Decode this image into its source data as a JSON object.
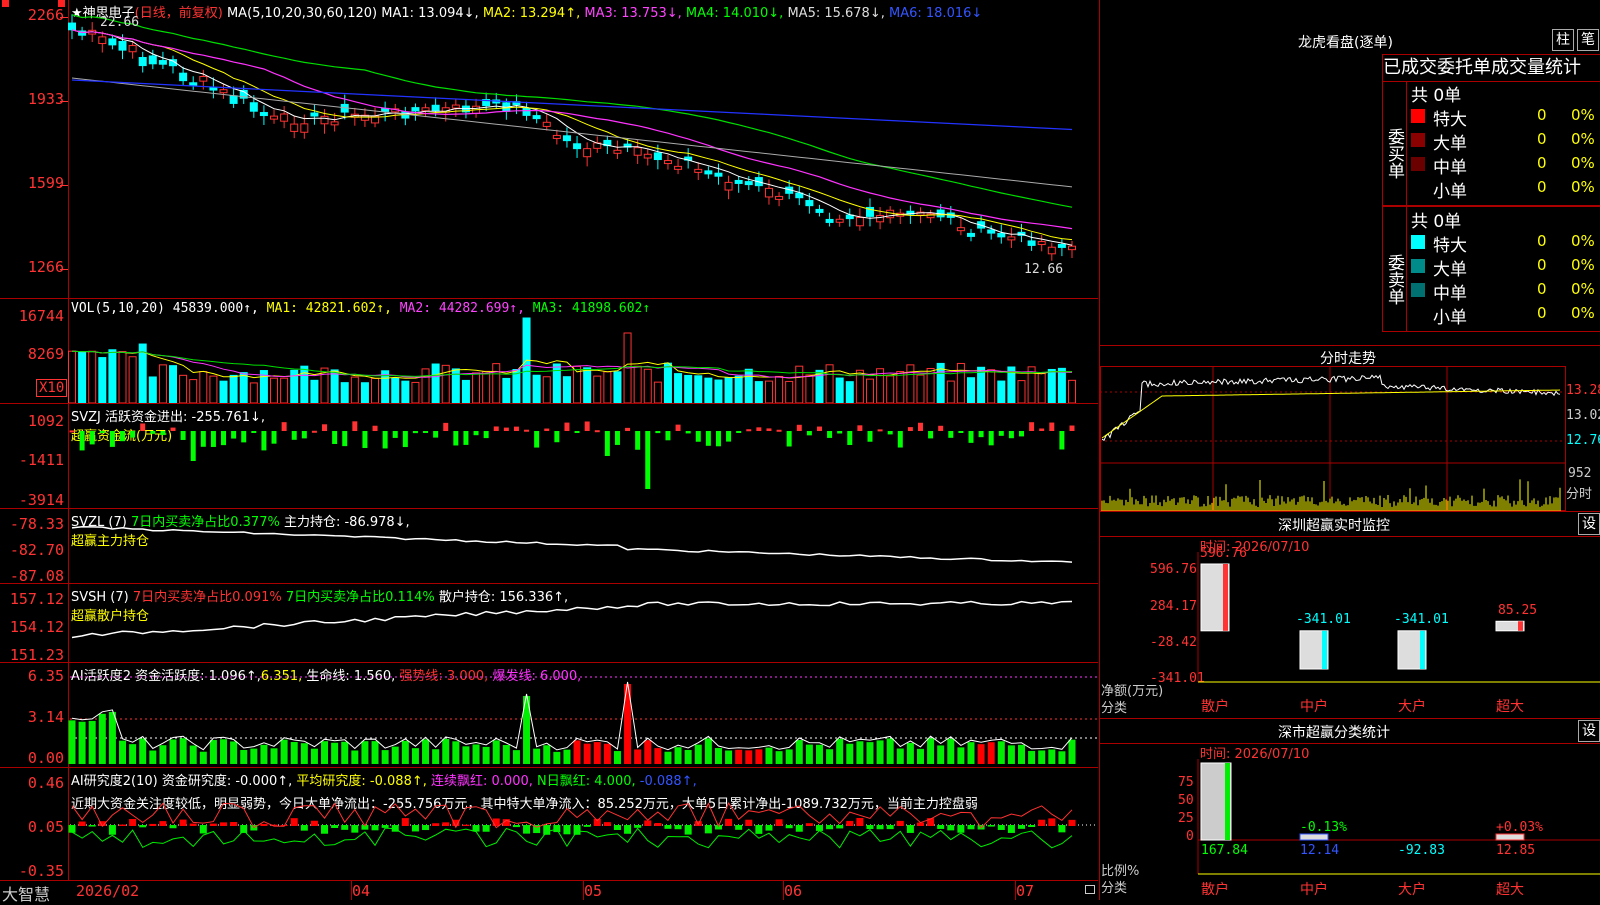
{
  "stock": {
    "name": "★神思电子",
    "period": "(日线，前复权)",
    "high_label": "22.66",
    "low_label": "12.66"
  },
  "price_ma": {
    "prefix": "MA(5,10,20,30,60,120)",
    "ma1": "MA1: 13.094↓,",
    "ma2": "MA2: 13.294↑,",
    "ma3": "MA3: 13.753↓,",
    "ma4": "MA4: 14.010↓,",
    "ma5": "MA5: 15.678↓,",
    "ma6": "MA6: 18.016↓",
    "ticks": [
      "2266",
      "1933",
      "1599",
      "1266"
    ]
  },
  "vol": {
    "prefix": "VOL(5,10,20)",
    "value": "45839.000↑,",
    "ma1": "MA1: 42821.602↑,",
    "ma2": "MA2: 44282.699↑,",
    "ma3": "MA3: 41898.602↑",
    "ticks": [
      "16744",
      "8269"
    ],
    "unit": "X10"
  },
  "svzj": {
    "line1": "SVZJ  活跃资金进出: -255.761↓,",
    "line2": "超赢资金流(万元)",
    "ticks": [
      "1092",
      "-1411",
      "-3914"
    ]
  },
  "svzl": {
    "p1": "SVZL (7)",
    "p2": "7日内买卖净占比0.377%",
    "p3": "主力持仓: -86.978↓,",
    "line2": "超赢主力持仓",
    "ticks": [
      "-78.33",
      "-82.70",
      "-87.08"
    ]
  },
  "svsh": {
    "p1": "SVSH (7)",
    "p2": "7日内买卖净占比0.091%",
    "p3": "7日内买卖净占比0.114%",
    "p4": "散户持仓: 156.336↑,",
    "line2": "超赢散户持仓",
    "ticks": [
      "157.12",
      "154.12",
      "151.23"
    ]
  },
  "ai_active": {
    "p1": "AI活跃度2",
    "p2": "资金活跃度: 1.096↑,",
    "p3": "6.351,",
    "p4": "生命线: 1.560,",
    "p5": "强势线: 3.000,",
    "p6": "爆发线: 6.000,",
    "ticks": [
      "6.35",
      "3.14",
      "0.00"
    ]
  },
  "ai_research": {
    "p1": "AI研究度2(10)",
    "p2": "资金研究度: -0.000↑,",
    "p3": "平均研究度: -0.088↑,",
    "p4": "连续飘红: 0.000,",
    "p5": "N日飘红: 4.000,",
    "p6": "-0.088↑,",
    "comment": "近期大资金关注度较低，明显弱势，今日大单净流出：-255.756万元，其中特大单净流入：85.252万元，大单5日累计净出-1089.732万元，当前主力控盘弱",
    "ticks": [
      "0.46",
      "0.05",
      "-0.35"
    ]
  },
  "date_axis": {
    "brand": "大智慧",
    "labels": [
      "2026/02",
      "04",
      "05",
      "06",
      "07"
    ]
  },
  "longhu": {
    "title": "龙虎看盘(逐单)",
    "btn_bar": "柱",
    "btn_pen": "笔",
    "subtitle": "已成交委托单成交量统计",
    "buy_label": "委买单",
    "sell_label": "委卖单",
    "buy_total": "共 0单",
    "sell_total": "共 0单",
    "rows": [
      {
        "name": "特大",
        "count": "0",
        "pct": "0%"
      },
      {
        "name": "大单",
        "count": "0",
        "pct": "0%"
      },
      {
        "name": "中单",
        "count": "0",
        "pct": "0%"
      },
      {
        "name": "小单",
        "count": "0",
        "pct": "0%"
      }
    ],
    "buy_colors": [
      "#ff0000",
      "#8b0000",
      "#6b0000",
      "#000000"
    ],
    "sell_colors": [
      "#00ffff",
      "#008b8b",
      "#007070",
      "#000000"
    ]
  },
  "intraday": {
    "title": "分时走势",
    "ticks": [
      "13.28",
      "13.02",
      "12.76"
    ],
    "vol_tick": "952",
    "vol_label": "分时"
  },
  "sz_monitor": {
    "title": "深圳超赢实时监控",
    "btn": "设",
    "time": "时间: 2026/07/10",
    "ticks": [
      "596.76",
      "284.17",
      "-28.42",
      "-341.01"
    ],
    "ylabel1": "净额(万元)",
    "ylabel2": "分类",
    "bar_labels": [
      "596.76",
      "-341.01",
      "-341.01",
      "85.25"
    ],
    "categories": [
      "散户",
      "中户",
      "大户",
      "超大"
    ]
  },
  "sz_class": {
    "title": "深市超赢分类统计",
    "btn": "设",
    "time": "时间: 2026/07/10",
    "ticks": [
      "75",
      "50",
      "25",
      "0"
    ],
    "ylabel1": "比例%",
    "ylabel2": "分类",
    "pct_labels": [
      "-0.13%",
      "+0.03%"
    ],
    "values": [
      "167.84",
      "12.14",
      "-92.83",
      "12.85"
    ],
    "categories": [
      "散户",
      "中户",
      "大户",
      "超大"
    ]
  }
}
